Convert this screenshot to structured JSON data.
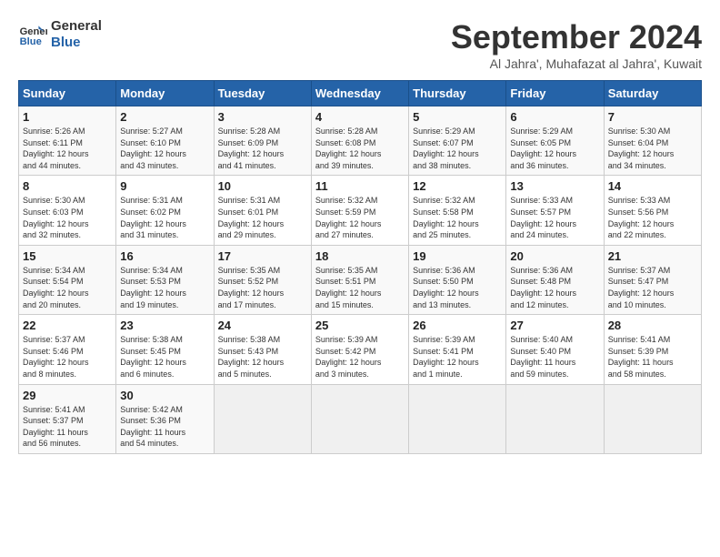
{
  "logo": {
    "line1": "General",
    "line2": "Blue"
  },
  "title": "September 2024",
  "location": "Al Jahra', Muhafazat al Jahra', Kuwait",
  "weekdays": [
    "Sunday",
    "Monday",
    "Tuesday",
    "Wednesday",
    "Thursday",
    "Friday",
    "Saturday"
  ],
  "days": [
    {
      "date": 1,
      "sunrise": "5:26 AM",
      "sunset": "6:11 PM",
      "daylight": "12 hours and 44 minutes."
    },
    {
      "date": 2,
      "sunrise": "5:27 AM",
      "sunset": "6:10 PM",
      "daylight": "12 hours and 43 minutes."
    },
    {
      "date": 3,
      "sunrise": "5:28 AM",
      "sunset": "6:09 PM",
      "daylight": "12 hours and 41 minutes."
    },
    {
      "date": 4,
      "sunrise": "5:28 AM",
      "sunset": "6:08 PM",
      "daylight": "12 hours and 39 minutes."
    },
    {
      "date": 5,
      "sunrise": "5:29 AM",
      "sunset": "6:07 PM",
      "daylight": "12 hours and 38 minutes."
    },
    {
      "date": 6,
      "sunrise": "5:29 AM",
      "sunset": "6:05 PM",
      "daylight": "12 hours and 36 minutes."
    },
    {
      "date": 7,
      "sunrise": "5:30 AM",
      "sunset": "6:04 PM",
      "daylight": "12 hours and 34 minutes."
    },
    {
      "date": 8,
      "sunrise": "5:30 AM",
      "sunset": "6:03 PM",
      "daylight": "12 hours and 32 minutes."
    },
    {
      "date": 9,
      "sunrise": "5:31 AM",
      "sunset": "6:02 PM",
      "daylight": "12 hours and 31 minutes."
    },
    {
      "date": 10,
      "sunrise": "5:31 AM",
      "sunset": "6:01 PM",
      "daylight": "12 hours and 29 minutes."
    },
    {
      "date": 11,
      "sunrise": "5:32 AM",
      "sunset": "5:59 PM",
      "daylight": "12 hours and 27 minutes."
    },
    {
      "date": 12,
      "sunrise": "5:32 AM",
      "sunset": "5:58 PM",
      "daylight": "12 hours and 25 minutes."
    },
    {
      "date": 13,
      "sunrise": "5:33 AM",
      "sunset": "5:57 PM",
      "daylight": "12 hours and 24 minutes."
    },
    {
      "date": 14,
      "sunrise": "5:33 AM",
      "sunset": "5:56 PM",
      "daylight": "12 hours and 22 minutes."
    },
    {
      "date": 15,
      "sunrise": "5:34 AM",
      "sunset": "5:54 PM",
      "daylight": "12 hours and 20 minutes."
    },
    {
      "date": 16,
      "sunrise": "5:34 AM",
      "sunset": "5:53 PM",
      "daylight": "12 hours and 19 minutes."
    },
    {
      "date": 17,
      "sunrise": "5:35 AM",
      "sunset": "5:52 PM",
      "daylight": "12 hours and 17 minutes."
    },
    {
      "date": 18,
      "sunrise": "5:35 AM",
      "sunset": "5:51 PM",
      "daylight": "12 hours and 15 minutes."
    },
    {
      "date": 19,
      "sunrise": "5:36 AM",
      "sunset": "5:50 PM",
      "daylight": "12 hours and 13 minutes."
    },
    {
      "date": 20,
      "sunrise": "5:36 AM",
      "sunset": "5:48 PM",
      "daylight": "12 hours and 12 minutes."
    },
    {
      "date": 21,
      "sunrise": "5:37 AM",
      "sunset": "5:47 PM",
      "daylight": "12 hours and 10 minutes."
    },
    {
      "date": 22,
      "sunrise": "5:37 AM",
      "sunset": "5:46 PM",
      "daylight": "12 hours and 8 minutes."
    },
    {
      "date": 23,
      "sunrise": "5:38 AM",
      "sunset": "5:45 PM",
      "daylight": "12 hours and 6 minutes."
    },
    {
      "date": 24,
      "sunrise": "5:38 AM",
      "sunset": "5:43 PM",
      "daylight": "12 hours and 5 minutes."
    },
    {
      "date": 25,
      "sunrise": "5:39 AM",
      "sunset": "5:42 PM",
      "daylight": "12 hours and 3 minutes."
    },
    {
      "date": 26,
      "sunrise": "5:39 AM",
      "sunset": "5:41 PM",
      "daylight": "12 hours and 1 minute."
    },
    {
      "date": 27,
      "sunrise": "5:40 AM",
      "sunset": "5:40 PM",
      "daylight": "11 hours and 59 minutes."
    },
    {
      "date": 28,
      "sunrise": "5:41 AM",
      "sunset": "5:39 PM",
      "daylight": "11 hours and 58 minutes."
    },
    {
      "date": 29,
      "sunrise": "5:41 AM",
      "sunset": "5:37 PM",
      "daylight": "11 hours and 56 minutes."
    },
    {
      "date": 30,
      "sunrise": "5:42 AM",
      "sunset": "5:36 PM",
      "daylight": "11 hours and 54 minutes."
    }
  ],
  "start_weekday": 0
}
